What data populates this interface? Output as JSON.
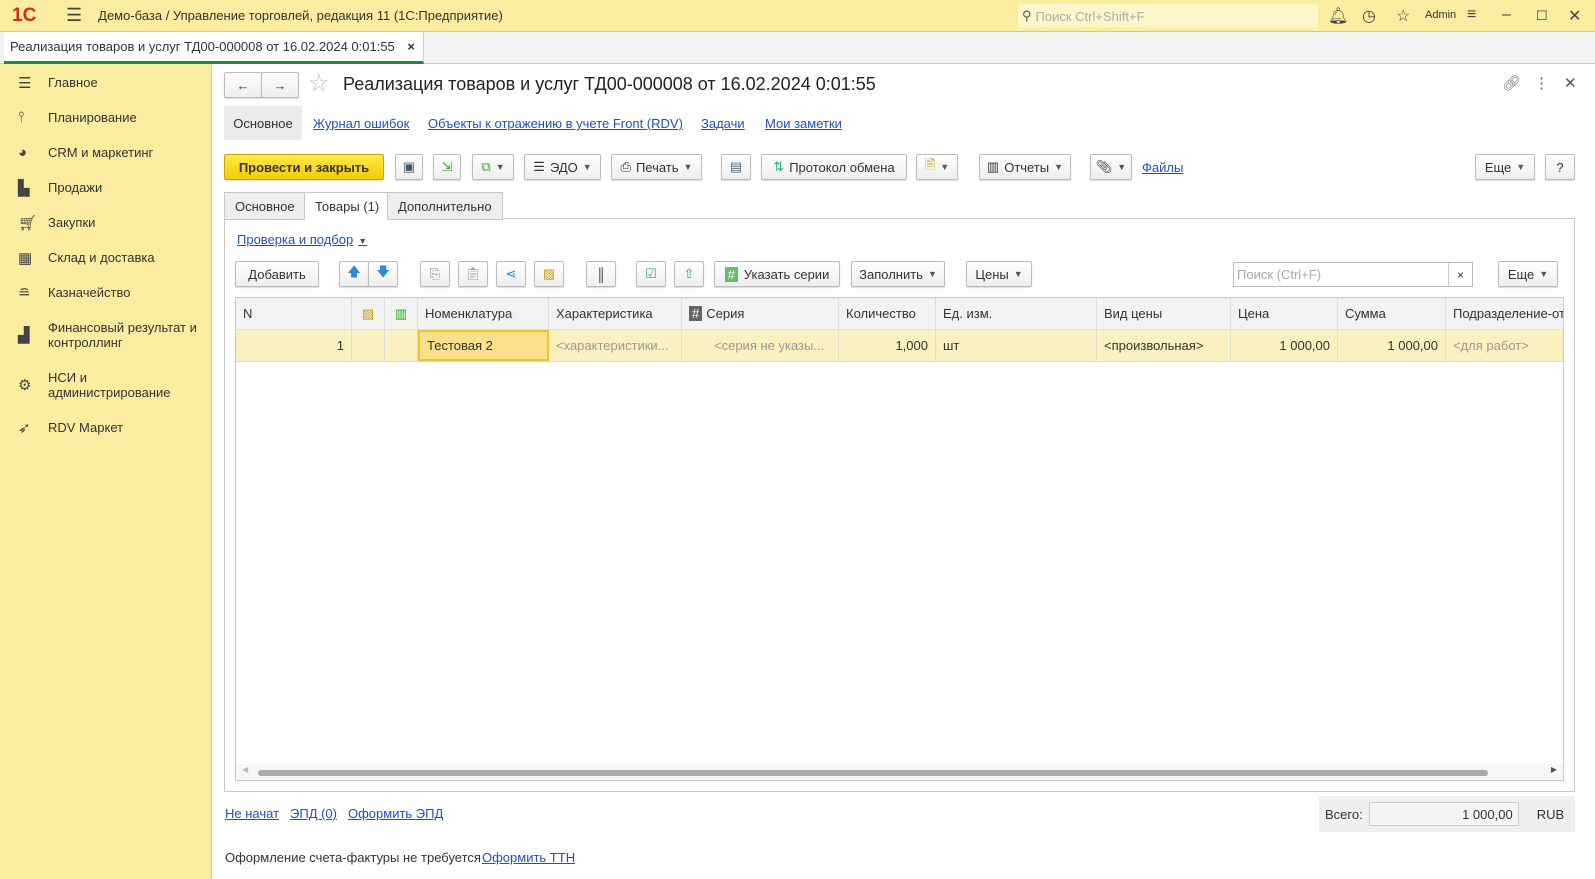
{
  "app": {
    "title": "Демо-база / Управление торговлей, редакция 11  (1С:Предприятие)",
    "search_placeholder": "Поиск Ctrl+Shift+F",
    "user": "Admin",
    "logo": "1С"
  },
  "doc_tab": {
    "label": "Реализация товаров и услуг ТД00-000008 от 16.02.2024 0:01:55",
    "close": "×"
  },
  "sidebar": {
    "items": [
      {
        "label": "Главное",
        "icon": "menu-icon"
      },
      {
        "label": "Планирование",
        "icon": "chart-icon"
      },
      {
        "label": "CRM и маркетинг",
        "icon": "pie-icon"
      },
      {
        "label": "Продажи",
        "icon": "bag-icon"
      },
      {
        "label": "Закупки",
        "icon": "cart-icon"
      },
      {
        "label": "Склад и доставка",
        "icon": "grid-icon"
      },
      {
        "label": "Казначейство",
        "icon": "coins-icon"
      },
      {
        "label": "Финансовый результат и контроллинг",
        "icon": "bar-chart-icon"
      },
      {
        "label": "НСИ и администрирование",
        "icon": "gear-icon"
      },
      {
        "label": "RDV Маркет",
        "icon": "rocket-icon"
      }
    ]
  },
  "header": {
    "title": "Реализация товаров и услуг ТД00-000008 от 16.02.2024 0:01:55"
  },
  "nav_links": {
    "main": "Основное",
    "errors": "Журнал ошибок",
    "objects": "Объекты к отражению в учете Front (RDV)",
    "tasks": "Задачи",
    "notes": "Мои заметки"
  },
  "toolbar": {
    "post_close": "Провести и закрыть",
    "edo": "ЭДО",
    "print": "Печать",
    "protocol": "Протокол обмена",
    "reports": "Отчеты",
    "files": "Файлы",
    "more": "Еще",
    "help": "?"
  },
  "tabs": {
    "main": "Основное",
    "goods": "Товары (1)",
    "extra": "Дополнительно"
  },
  "goods": {
    "check_link": "Проверка и подбор",
    "add": "Добавить",
    "series": "Указать серии",
    "fill": "Заполнить",
    "prices": "Цены",
    "search_placeholder": "Поиск (Ctrl+F)",
    "search_clear": "×",
    "more": "Еще",
    "columns": [
      "N",
      "",
      "",
      "Номенклатура",
      "Характеристика",
      "Серия",
      "Количество",
      "Ед. изм.",
      "Вид цены",
      "Цена",
      "Сумма",
      "Подразделение-от"
    ],
    "rows": [
      {
        "n": "1",
        "nomenclature": "Тестовая 2",
        "characteristic": "<характеристики...",
        "series": "<серия не указы...",
        "qty": "1,000",
        "unit": "шт",
        "price_type": "<произвольная>",
        "price": "1 000,00",
        "sum": "1 000,00",
        "division": "<для работ>"
      }
    ]
  },
  "footer": {
    "status": "Не начат",
    "epd": "ЭПД (0)",
    "make_epd": "Оформить ЭПД",
    "total_label": "Всего:",
    "total": "1 000,00",
    "currency": "RUB",
    "invoice_text": "Оформление счета-фактуры не требуется",
    "make_ttn": "Оформить ТТН"
  }
}
